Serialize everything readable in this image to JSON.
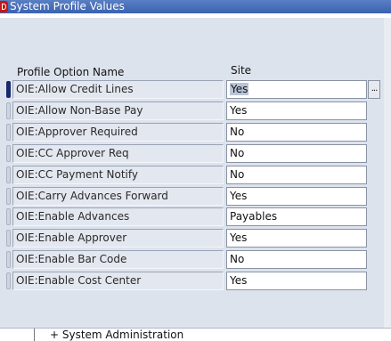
{
  "window": {
    "title": "System Profile Values"
  },
  "columns": {
    "name": "Profile Option Name",
    "site": "Site"
  },
  "rows": [
    {
      "name": "OIE:Allow Credit Lines",
      "site": "Yes"
    },
    {
      "name": "OIE:Allow Non-Base Pay",
      "site": "Yes"
    },
    {
      "name": "OIE:Approver Required",
      "site": "No"
    },
    {
      "name": "OIE:CC Approver Req",
      "site": "No"
    },
    {
      "name": "OIE:CC Payment Notify",
      "site": "No"
    },
    {
      "name": "OIE:Carry Advances Forward",
      "site": "Yes"
    },
    {
      "name": "OIE:Enable Advances",
      "site": "Payables"
    },
    {
      "name": "OIE:Enable Approver",
      "site": "Yes"
    },
    {
      "name": "OIE:Enable Bar Code",
      "site": "No"
    },
    {
      "name": "OIE:Enable Cost Center",
      "site": "Yes"
    }
  ],
  "lov_button": {
    "label": "..."
  },
  "bottom": {
    "tree_item": "+ System Administration"
  },
  "colors": {
    "titlebar": "#3a62b0",
    "active_marker": "#1a2a6c"
  }
}
